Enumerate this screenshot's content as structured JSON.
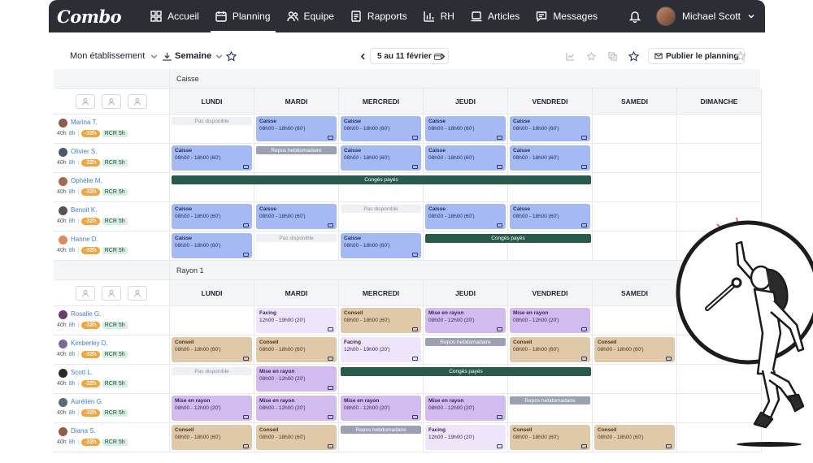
{
  "app": {
    "logo": "Combo",
    "nav": [
      {
        "label": "Accueil",
        "icon": "grid-icon"
      },
      {
        "label": "Planning",
        "icon": "calendar-icon",
        "active": true
      },
      {
        "label": "Equipe",
        "icon": "team-icon"
      },
      {
        "label": "Rapports",
        "icon": "report-icon"
      },
      {
        "label": "RH",
        "icon": "chart-icon"
      },
      {
        "label": "Articles",
        "icon": "laptop-icon"
      },
      {
        "label": "Messages",
        "icon": "message-icon"
      }
    ],
    "user_name": "Michael Scott"
  },
  "toolbar": {
    "establishment": "Mon établissement",
    "period": "Semaine",
    "week_range": "5 au 11 février",
    "publish_label": "Publier le planning"
  },
  "sections": [
    {
      "label": "Caisse",
      "days": [
        "LUNDI",
        "MARDI",
        "MERCREDI",
        "JEUDI",
        "VENDREDI",
        "SAMEDI",
        "DIMANCHE"
      ]
    },
    {
      "label": "Rayon 1",
      "days": [
        "LUNDI",
        "MARDI",
        "MERCREDI",
        "JEUDI",
        "VENDREDI",
        "SAMEDI"
      ]
    }
  ],
  "employees": [
    {
      "name": "Marina T.",
      "hours": "40h",
      "base": "8h",
      "diff": "-32h",
      "rcr": "RCR 5h",
      "avatar_color": "#8e5b4a"
    },
    {
      "name": "Olivier S.",
      "hours": "40h",
      "base": "8h",
      "diff": "-32h",
      "rcr": "RCR 5h",
      "avatar_color": "#4a5a6e"
    },
    {
      "name": "Ophélie M.",
      "hours": "40h",
      "base": "8h",
      "diff": "-32h",
      "rcr": "RCR 5h",
      "avatar_color": "#a56a4c"
    },
    {
      "name": "Benoit K.",
      "hours": "40h",
      "base": "8h",
      "diff": "-32h",
      "rcr": "RCR 5h",
      "avatar_color": "#555555"
    },
    {
      "name": "Hanne D.",
      "hours": "40h",
      "base": "8h",
      "diff": "-32h",
      "rcr": "RCR 5h",
      "avatar_color": "#e08a5a"
    },
    {
      "name": "Rosalie G.",
      "hours": "40h",
      "base": "8h",
      "diff": "-32h",
      "rcr": "RCR 5h",
      "avatar_color": "#6b3b6b"
    },
    {
      "name": "Kimberley D.",
      "hours": "40h",
      "base": "8h",
      "diff": "-32h",
      "rcr": "RCR 5h",
      "avatar_color": "#7a6a9a"
    },
    {
      "name": "Scott L.",
      "hours": "40h",
      "base": "8h",
      "diff": "-32h",
      "rcr": "RCR 5h",
      "avatar_color": "#2a2a2a"
    },
    {
      "name": "Aurélien G.",
      "hours": "40h",
      "base": "8h",
      "diff": "-32h",
      "rcr": "RCR 5h",
      "avatar_color": "#5a6a7a"
    },
    {
      "name": "Diana S.",
      "hours": "40h",
      "base": "8h",
      "diff": "-32h",
      "rcr": "RCR 5h",
      "avatar_color": "#9a5a4a"
    }
  ],
  "shift_text": {
    "caisse": "Caisse",
    "conseil": "Conseil",
    "facing": "Facing",
    "mise": "Mise en rayon",
    "t60": "08h00 - 18h00 (60')",
    "t20a": "12h00 - 19h00 (20')",
    "t20b": "08h00 - 12h00 (20')",
    "pas_dispo": "Pas disponible",
    "repos": "Repos hebdomadaire",
    "conges": "Congés payés"
  },
  "colors": {
    "topbar": "#2b2e34",
    "caisse": "#a5baf5",
    "mise_en_rayon": "#d2bcef",
    "facing": "#efe5fa",
    "conseil": "#e0c9a8",
    "conges": "#285b4e",
    "repos": "#9aa1b0",
    "pas_dispo": "#eef0f3",
    "diff_badge": "#f3a53b",
    "rcr_badge": "#d7f0e3"
  }
}
